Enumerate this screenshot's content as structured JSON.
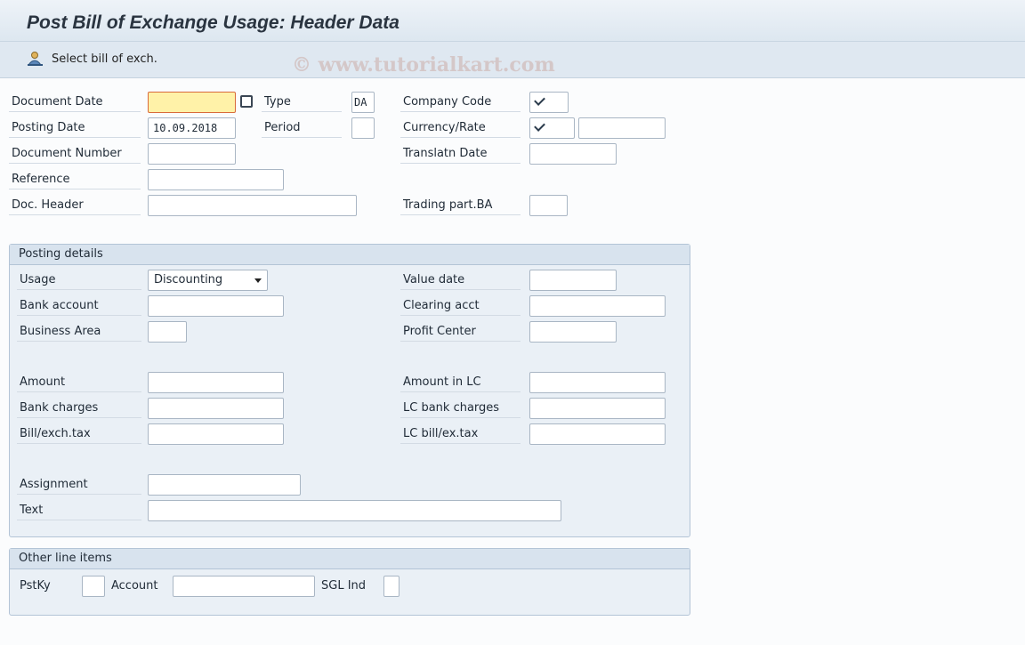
{
  "header": {
    "title": "Post Bill of Exchange Usage: Header Data"
  },
  "toolbar": {
    "select_bill": "Select bill of exch.",
    "select_icon": "person-select-icon"
  },
  "watermark": "© www.tutorialkart.com",
  "header_fields": {
    "document_date": {
      "label": "Document Date",
      "value": ""
    },
    "type": {
      "label": "Type",
      "value": "DA"
    },
    "company_code": {
      "label": "Company Code"
    },
    "posting_date": {
      "label": "Posting Date",
      "value": "10.09.2018"
    },
    "period": {
      "label": "Period",
      "value": ""
    },
    "currency_rate": {
      "label": "Currency/Rate",
      "value": ""
    },
    "document_number": {
      "label": "Document Number",
      "value": ""
    },
    "translatn_date": {
      "label": "Translatn Date",
      "value": ""
    },
    "reference": {
      "label": "Reference",
      "value": ""
    },
    "doc_header": {
      "label": "Doc. Header",
      "value": ""
    },
    "trading_part_ba": {
      "label": "Trading part.BA",
      "value": ""
    }
  },
  "posting_details": {
    "title": "Posting details",
    "usage": {
      "label": "Usage",
      "value": "Discounting"
    },
    "value_date": {
      "label": "Value date",
      "value": ""
    },
    "bank_account": {
      "label": "Bank account",
      "value": ""
    },
    "clearing_acct": {
      "label": "Clearing acct",
      "value": ""
    },
    "business_area": {
      "label": "Business Area",
      "value": ""
    },
    "profit_center": {
      "label": "Profit Center",
      "value": ""
    },
    "amount": {
      "label": "Amount",
      "value": ""
    },
    "amount_in_lc": {
      "label": "Amount in LC",
      "value": ""
    },
    "bank_charges": {
      "label": "Bank charges",
      "value": ""
    },
    "lc_bank_charges": {
      "label": "LC bank charges",
      "value": ""
    },
    "bill_exch_tax": {
      "label": "Bill/exch.tax",
      "value": ""
    },
    "lc_bill_ex_tax": {
      "label": "LC bill/ex.tax",
      "value": ""
    },
    "assignment": {
      "label": "Assignment",
      "value": ""
    },
    "text": {
      "label": "Text",
      "value": ""
    }
  },
  "other_line_items": {
    "title": "Other line items",
    "pstky": {
      "label": "PstKy",
      "value": ""
    },
    "account": {
      "label": "Account",
      "value": ""
    },
    "sgl_ind": {
      "label": "SGL Ind",
      "value": ""
    }
  }
}
